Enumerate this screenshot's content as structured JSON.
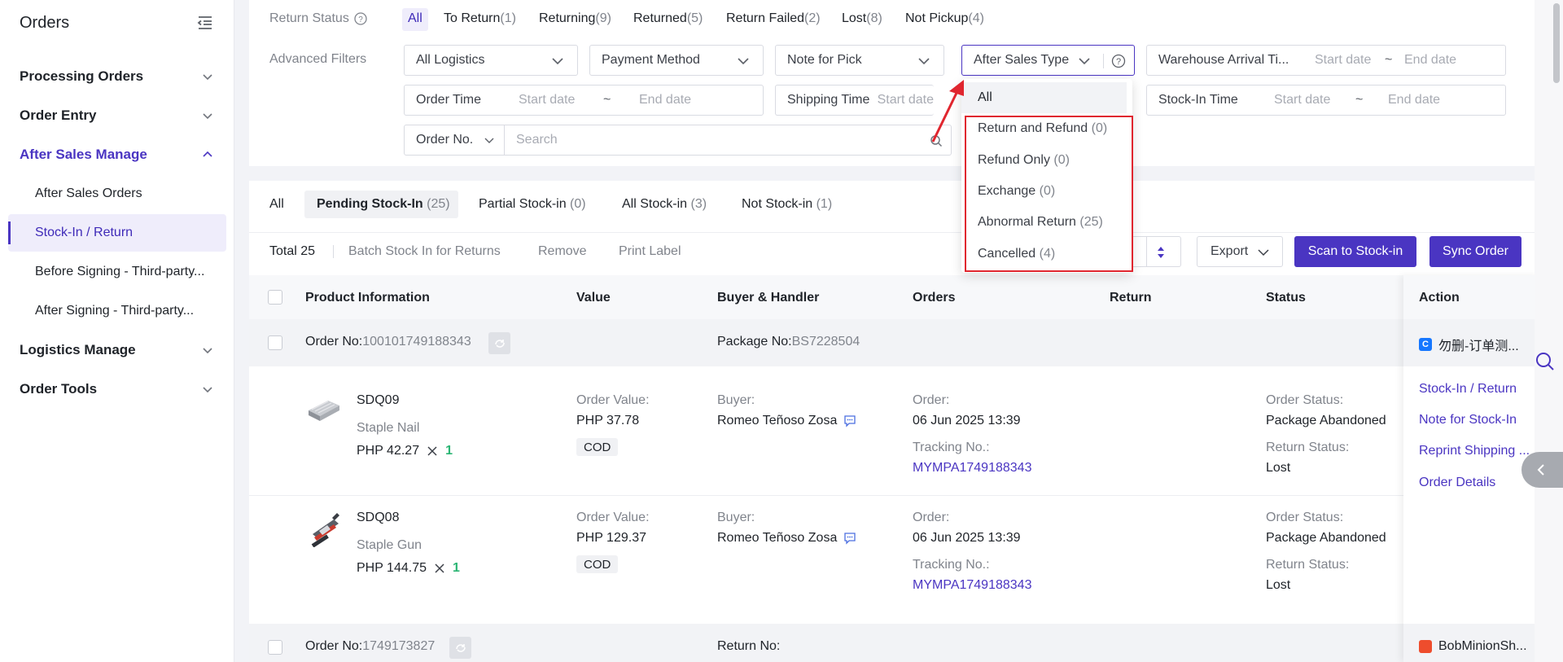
{
  "sidebar": {
    "title": "Orders",
    "groups": [
      {
        "label": "Processing Orders"
      },
      {
        "label": "Order Entry"
      },
      {
        "label": "After Sales Manage"
      },
      {
        "label": "Logistics Manage"
      },
      {
        "label": "Order Tools"
      }
    ],
    "sub_items": [
      {
        "label": "After Sales Orders"
      },
      {
        "label": "Stock-In / Return"
      },
      {
        "label": "Before Signing - Third-party..."
      },
      {
        "label": "After Signing - Third-party..."
      }
    ]
  },
  "filters": {
    "return_status_label": "Return Status",
    "status_tabs": [
      {
        "label": "All",
        "count": ""
      },
      {
        "label": "To Return",
        "count": "(1)"
      },
      {
        "label": "Returning",
        "count": "(9)"
      },
      {
        "label": "Returned",
        "count": "(5)"
      },
      {
        "label": "Return Failed",
        "count": "(2)"
      },
      {
        "label": "Lost",
        "count": "(8)"
      },
      {
        "label": "Not Pickup",
        "count": "(4)"
      }
    ],
    "advanced_label": "Advanced Filters",
    "logistics": "All Logistics",
    "payment": "Payment Method",
    "note_pick": "Note for Pick",
    "after_sales_type": "After Sales Type",
    "warehouse_arrival": "Warehouse Arrival Ti...",
    "order_time": "Order Time",
    "shipping_time": "Shipping Time",
    "stock_in_time": "Stock-In Time",
    "start_date": "Start date",
    "end_date": "End date",
    "tilde": "~",
    "order_no": "Order No.",
    "search_placeholder": "Search"
  },
  "dropdown": {
    "items": [
      {
        "label": "All",
        "count": ""
      },
      {
        "label": "Return and Refund",
        "count": "(0)"
      },
      {
        "label": "Refund Only",
        "count": "(0)"
      },
      {
        "label": "Exchange",
        "count": "(0)"
      },
      {
        "label": "Abnormal Return",
        "count": "(25)"
      },
      {
        "label": "Cancelled",
        "count": "(4)"
      }
    ]
  },
  "stock_tabs": [
    {
      "label": "All",
      "count": ""
    },
    {
      "label": "Pending Stock-In",
      "count": "(25)"
    },
    {
      "label": "Partial Stock-in",
      "count": "(0)"
    },
    {
      "label": "All Stock-in",
      "count": "(3)"
    },
    {
      "label": "Not Stock-in",
      "count": "(1)"
    }
  ],
  "toolbar": {
    "total": "Total 25",
    "batch": "Batch Stock In for Returns",
    "remove": "Remove",
    "print": "Print Label",
    "export": "Export",
    "scan": "Scan to Stock-in",
    "sync": "Sync Order"
  },
  "table": {
    "columns": [
      "Product Information",
      "Value",
      "Buyer & Handler",
      "Orders",
      "Return",
      "Status",
      "Action"
    ],
    "order1": {
      "order_no_label": "Order No:",
      "order_no": "100101749188343",
      "package_label": "Package No:",
      "package_no": "BS7228504",
      "shop": "勿删-订单测...",
      "actions": [
        "Stock-In / Return",
        "Note for Stock-In",
        "Reprint Shipping ...",
        "Order Details"
      ],
      "items": [
        {
          "sku": "SDQ09",
          "name": "Staple Nail",
          "price": "PHP 42.27",
          "qty": "1",
          "value_label": "Order Value:",
          "value": "PHP 37.78",
          "payment": "COD",
          "buyer_label": "Buyer:",
          "buyer": "Romeo Teñoso Zosa",
          "order_label": "Order:",
          "order_time": "06 Jun 2025 13:39",
          "tracking_label": "Tracking No.:",
          "tracking": "MYMPA1749188343",
          "order_status_label": "Order Status:",
          "order_status": "Package Abandoned",
          "return_status_label": "Return Status:",
          "return_status": "Lost"
        },
        {
          "sku": "SDQ08",
          "name": "Staple Gun",
          "price": "PHP 144.75",
          "qty": "1",
          "value_label": "Order Value:",
          "value": "PHP 129.37",
          "payment": "COD",
          "buyer_label": "Buyer:",
          "buyer": "Romeo Teñoso Zosa",
          "order_label": "Order:",
          "order_time": "06 Jun 2025 13:39",
          "tracking_label": "Tracking No.:",
          "tracking": "MYMPA1749188343",
          "order_status_label": "Order Status:",
          "order_status": "Package Abandoned",
          "return_status_label": "Return Status:",
          "return_status": "Lost"
        }
      ]
    },
    "order2": {
      "order_no_label": "Order No:",
      "order_no": "1749173827",
      "return_label": "Return No:",
      "shop": "BobMinionSh..."
    }
  }
}
